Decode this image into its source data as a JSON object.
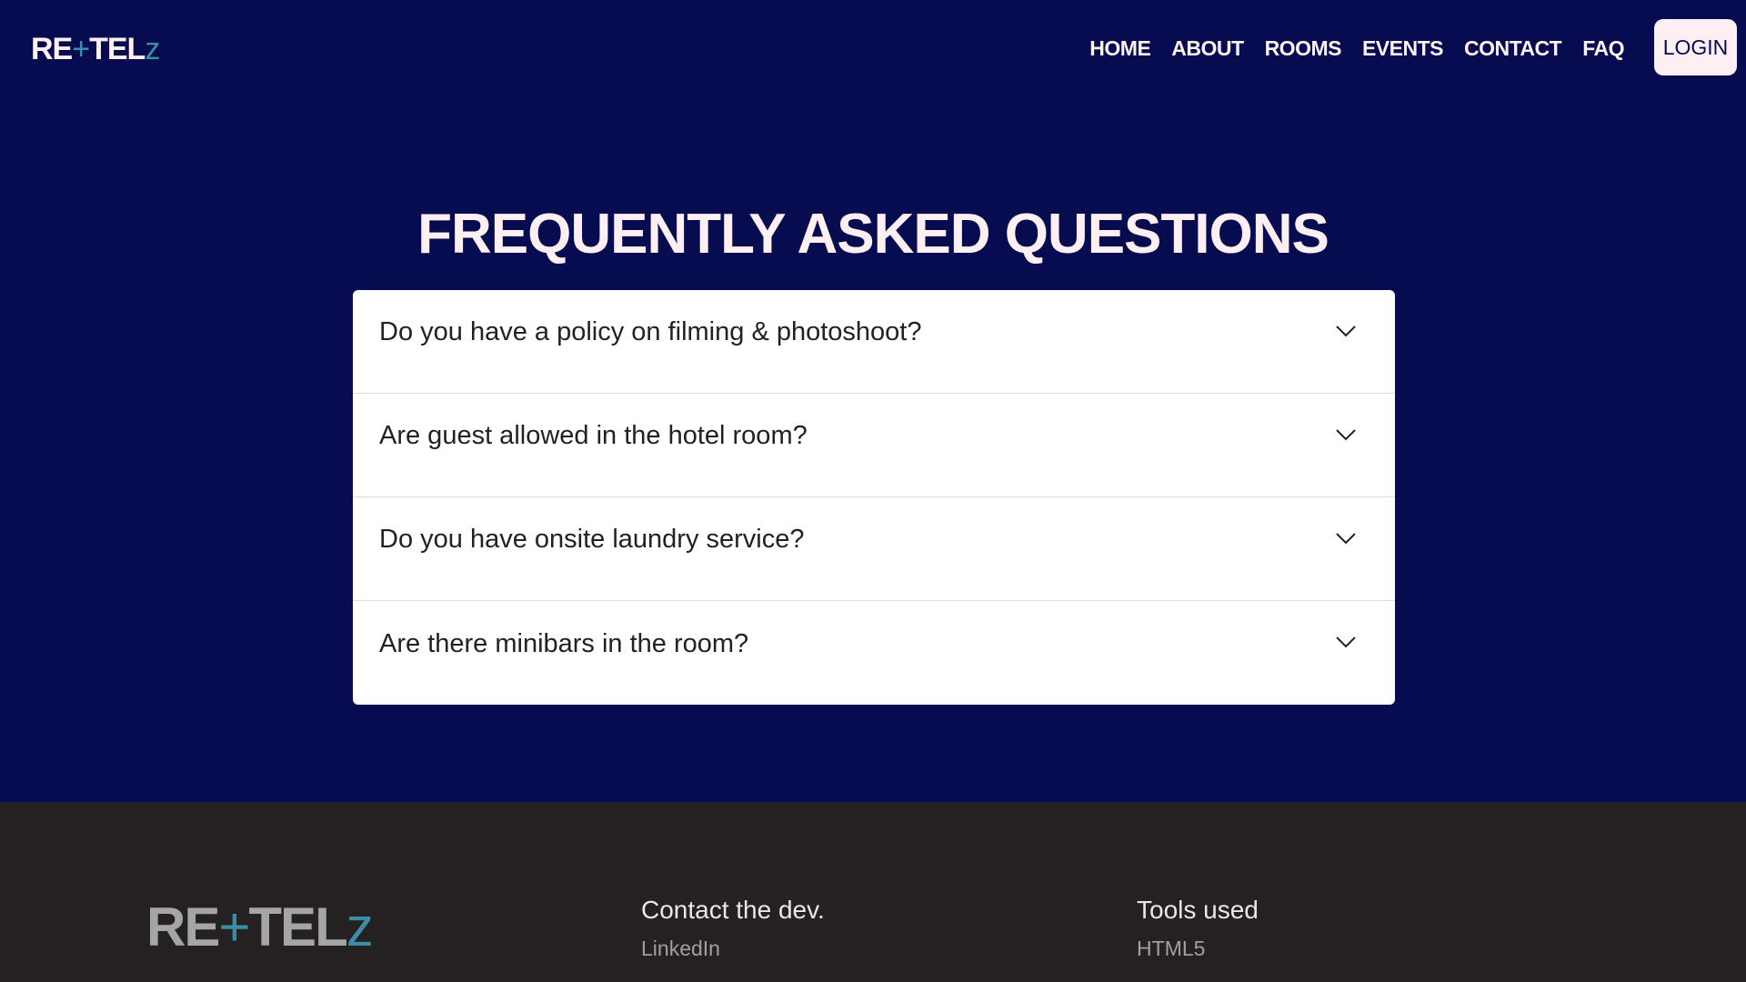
{
  "brand": {
    "part1": "RE",
    "plus": "+",
    "part2": "TEL",
    "z": "z"
  },
  "nav": {
    "items": [
      "HOME",
      "ABOUT",
      "ROOMS",
      "EVENTS",
      "CONTACT",
      "FAQ"
    ],
    "login_label": "LOGIN"
  },
  "faq": {
    "title": "FREQUENTLY ASKED QUESTIONS",
    "questions": [
      "Do you have a policy on filming & photoshoot?",
      "Are guest allowed in the hotel room?",
      "Do you have onsite laundry service?",
      "Are there minibars in the room?"
    ],
    "expand_icon": "chevron-down-icon"
  },
  "footer": {
    "contact_heading": "Contact the dev.",
    "contact_link": "LinkedIn",
    "tools_heading": "Tools used",
    "tools_item": "HTML5"
  },
  "colors": {
    "background": "#070b50",
    "text_light": "#fdf0f0",
    "accent": "#3b8ea5",
    "login_bg": "#fdeff2",
    "footer_bg": "#252122"
  }
}
